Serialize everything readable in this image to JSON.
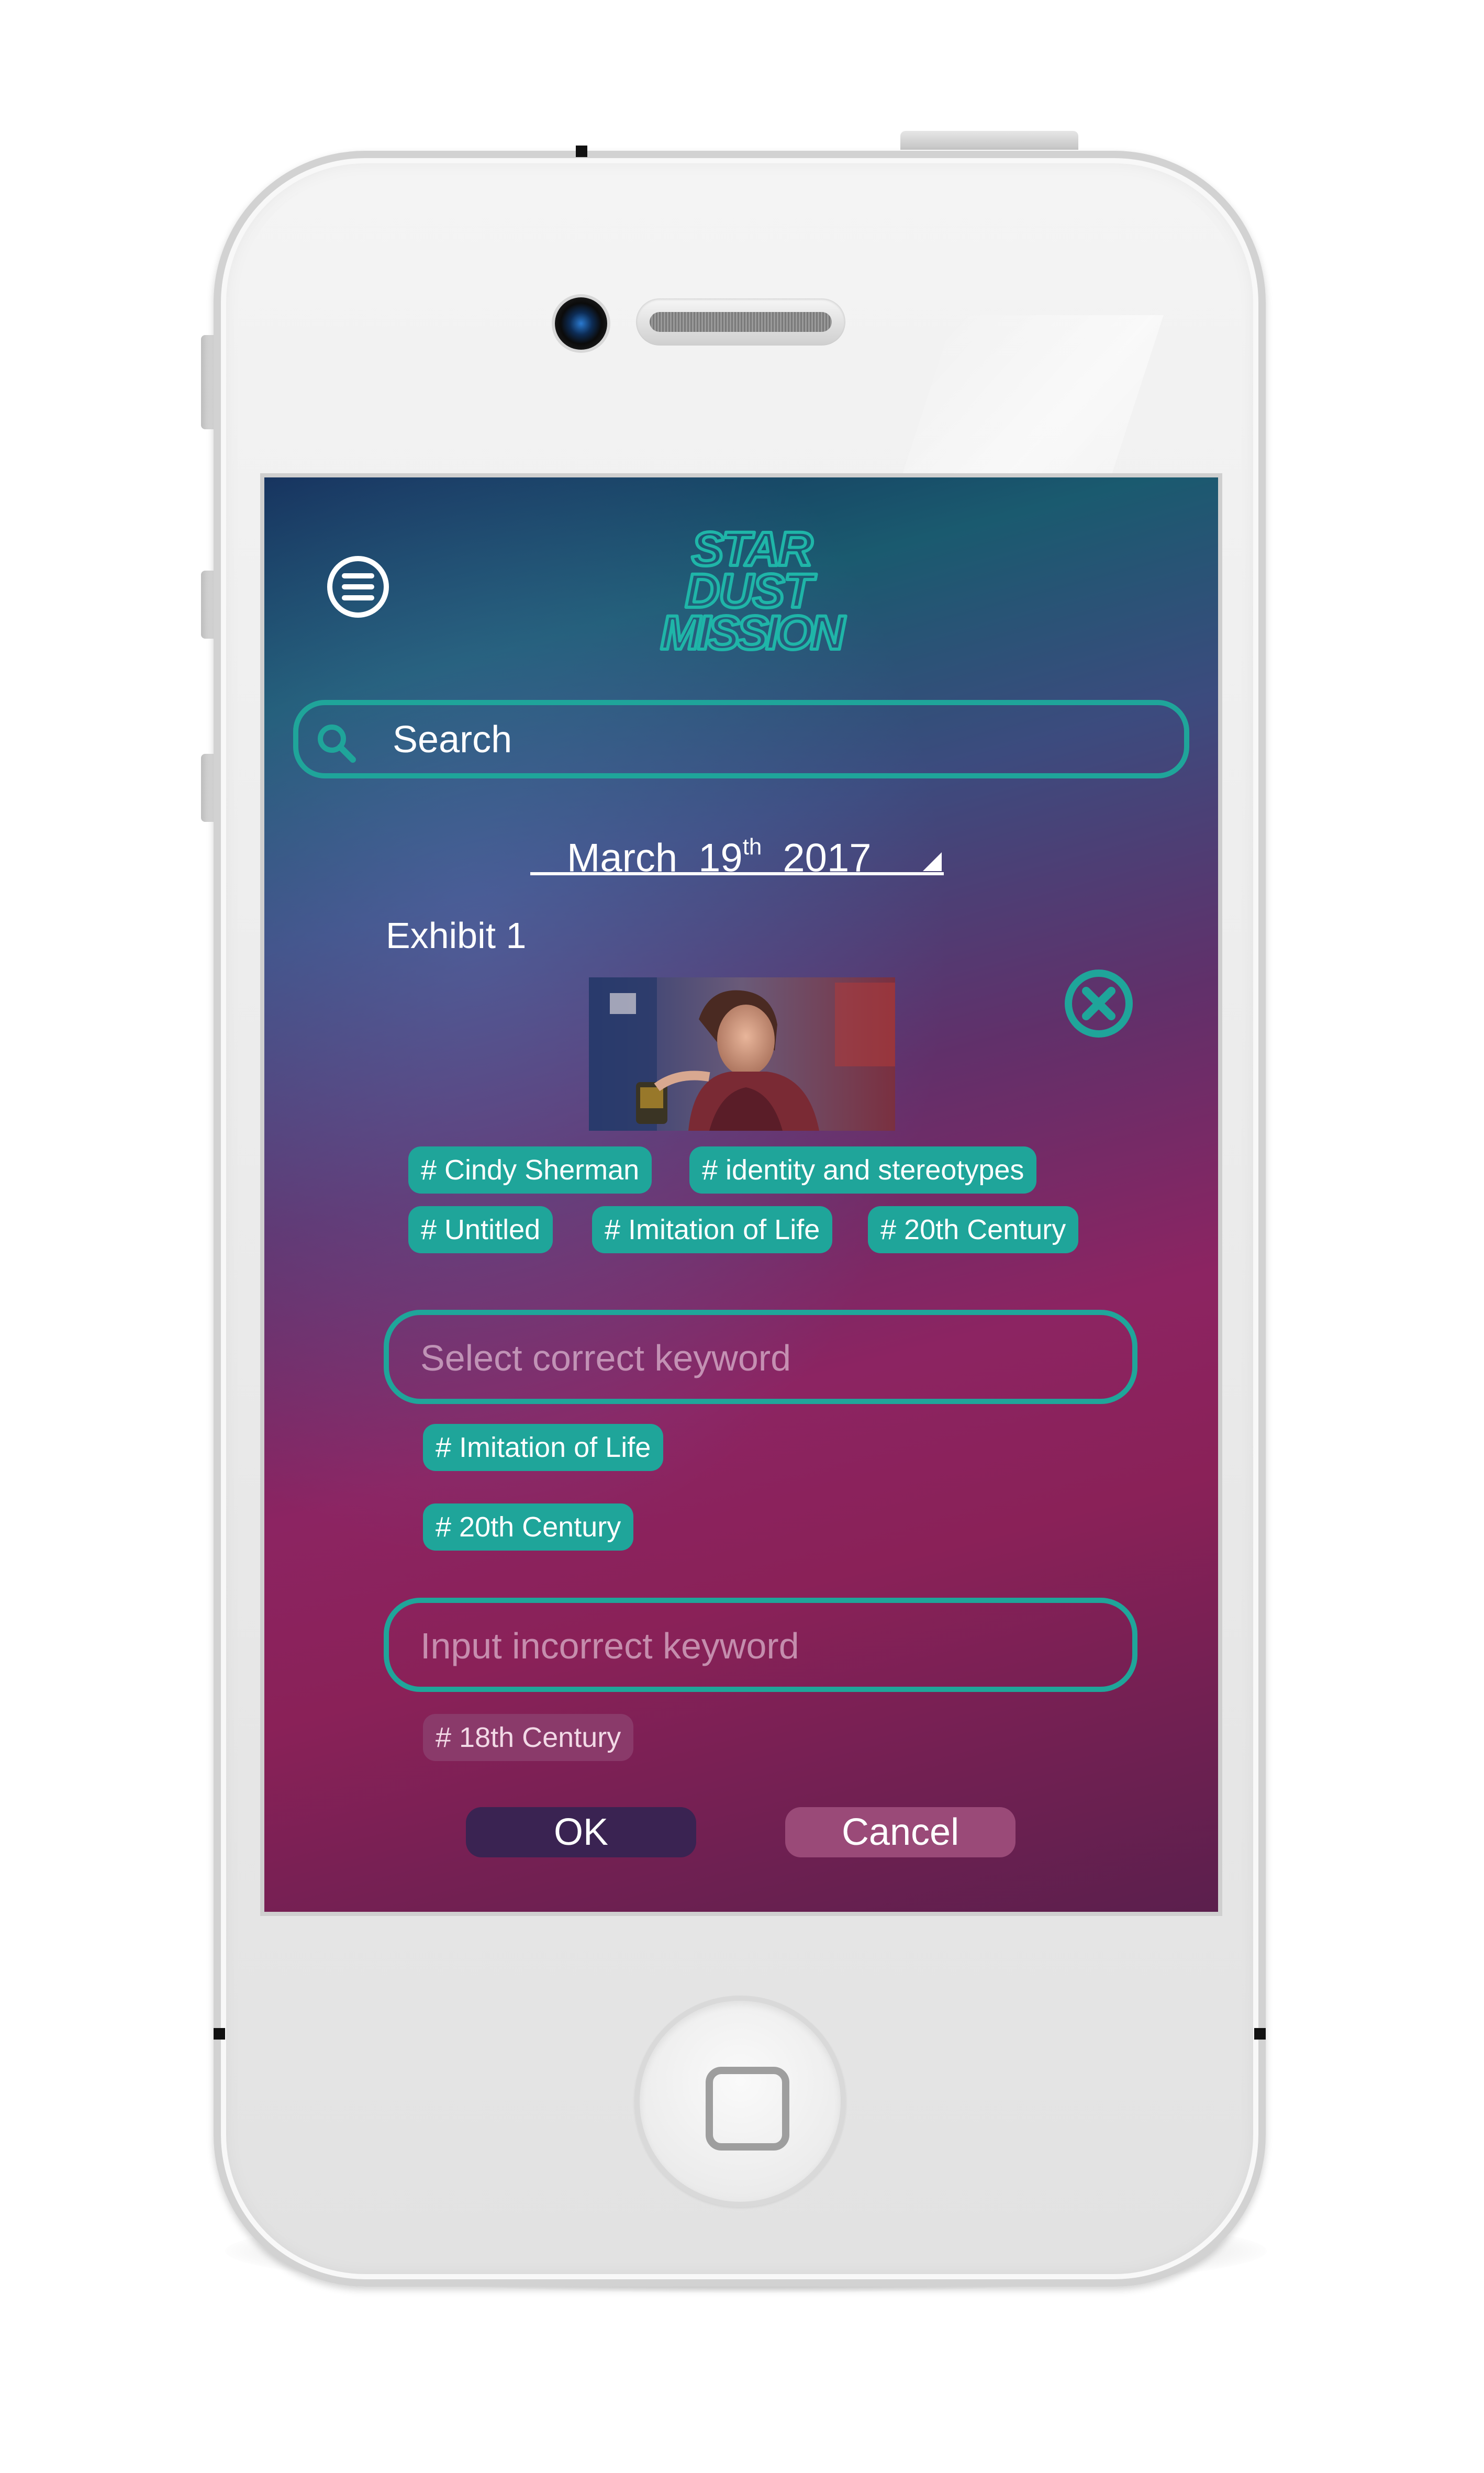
{
  "app": {
    "logo_text": [
      "STAR",
      "DUST",
      "MISSION"
    ]
  },
  "search": {
    "label": "Search"
  },
  "date": {
    "month": "March",
    "day": "19",
    "day_suffix": "th",
    "year": "2017"
  },
  "exhibit": {
    "title": "Exhibit 1"
  },
  "tags": [
    "# Cindy Sherman",
    "# identity and stereotypes",
    "# Untitled",
    "# Imitation of Life",
    "# 20th Century"
  ],
  "correct_keyword": {
    "placeholder": "Select correct keyword",
    "selected": [
      "# Imitation of Life",
      "# 20th Century"
    ]
  },
  "incorrect_keyword": {
    "placeholder": "Input incorrect keyword",
    "entered": [
      "# 18th Century"
    ]
  },
  "actions": {
    "ok": "OK",
    "cancel": "Cancel"
  },
  "colors": {
    "accent": "#1fa59a",
    "ok_button": "#3a2352",
    "cancel_button": "#9a4a78",
    "muted_tag": "#8a3a6a"
  },
  "icons": {
    "menu": "menu-icon",
    "search": "search-icon",
    "close": "close-circle-icon",
    "dropdown": "dropdown-triangle-icon"
  }
}
